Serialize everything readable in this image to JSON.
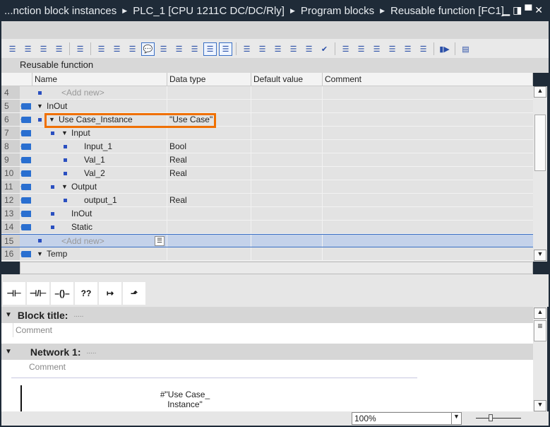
{
  "titlebar": {
    "crumbs": [
      "...nction block instances",
      "PLC_1 [CPU 1211C DC/DC/Rly]",
      "Program blocks",
      "Reusable function [FC1]"
    ]
  },
  "block_header": "Reusable function",
  "columns": [
    "Name",
    "Data type",
    "Default value",
    "Comment"
  ],
  "rows": [
    {
      "num": "4",
      "iface": false,
      "dot": true,
      "level": 1,
      "exp": false,
      "name": "<Add new>",
      "type": "",
      "addnew": true
    },
    {
      "num": "5",
      "iface": true,
      "dot": false,
      "level": 0,
      "exp": true,
      "name": "InOut",
      "type": ""
    },
    {
      "num": "6",
      "iface": true,
      "dot": true,
      "level": 1,
      "exp": true,
      "name": "Use Case_Instance",
      "type": "\"Use Case\""
    },
    {
      "num": "7",
      "iface": true,
      "dot": true,
      "level": 2,
      "exp": true,
      "name": "Input",
      "type": ""
    },
    {
      "num": "8",
      "iface": true,
      "dot": true,
      "level": 3,
      "exp": false,
      "name": "Input_1",
      "type": "Bool"
    },
    {
      "num": "9",
      "iface": true,
      "dot": true,
      "level": 3,
      "exp": false,
      "name": "Val_1",
      "type": "Real"
    },
    {
      "num": "10",
      "iface": true,
      "dot": true,
      "level": 3,
      "exp": false,
      "name": "Val_2",
      "type": "Real"
    },
    {
      "num": "11",
      "iface": true,
      "dot": true,
      "level": 2,
      "exp": true,
      "name": "Output",
      "type": ""
    },
    {
      "num": "12",
      "iface": true,
      "dot": true,
      "level": 3,
      "exp": false,
      "name": "output_1",
      "type": "Real"
    },
    {
      "num": "13",
      "iface": true,
      "dot": true,
      "level": 2,
      "exp": false,
      "name": "InOut",
      "type": ""
    },
    {
      "num": "14",
      "iface": true,
      "dot": true,
      "level": 2,
      "exp": false,
      "name": "Static",
      "type": ""
    },
    {
      "num": "15",
      "iface": false,
      "dot": true,
      "level": 1,
      "exp": false,
      "name": "<Add new>",
      "type": "",
      "addnew": true,
      "selected": true
    },
    {
      "num": "16",
      "iface": true,
      "dot": false,
      "level": 0,
      "exp": true,
      "name": "Temp",
      "type": ""
    }
  ],
  "lad_buttons": [
    {
      "name": "no-contact",
      "glyph": "⊣⊢"
    },
    {
      "name": "nc-contact",
      "glyph": "⊣/⊢"
    },
    {
      "name": "coil",
      "glyph": "–()–"
    },
    {
      "name": "empty-box",
      "glyph": "??"
    },
    {
      "name": "open-branch",
      "glyph": "↦"
    },
    {
      "name": "close-branch",
      "glyph": "⬏"
    }
  ],
  "editor": {
    "block_title": "Block title:",
    "dots": ".....",
    "comment": "Comment",
    "network": "Network 1:",
    "instance_label_1": "#\"Use Case_",
    "instance_label_2": "Instance\""
  },
  "status": {
    "zoom": "100%"
  }
}
